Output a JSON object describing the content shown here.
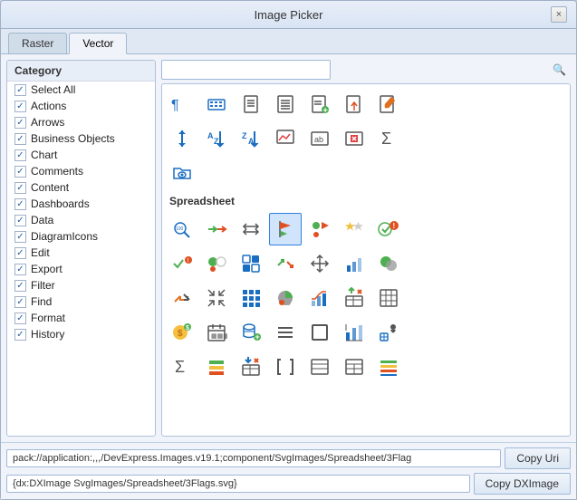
{
  "dialog": {
    "title": "Image Picker",
    "close_label": "×"
  },
  "tabs": [
    {
      "label": "Raster",
      "active": false
    },
    {
      "label": "Vector",
      "active": true
    }
  ],
  "sidebar": {
    "header": "Category",
    "items": [
      {
        "label": "Select All",
        "checked": true
      },
      {
        "label": "Actions",
        "checked": true
      },
      {
        "label": "Arrows",
        "checked": true
      },
      {
        "label": "Business Objects",
        "checked": true
      },
      {
        "label": "Chart",
        "checked": true
      },
      {
        "label": "Comments",
        "checked": true
      },
      {
        "label": "Content",
        "checked": true
      },
      {
        "label": "Dashboards",
        "checked": true
      },
      {
        "label": "Data",
        "checked": true
      },
      {
        "label": "DiagramIcons",
        "checked": true
      },
      {
        "label": "Edit",
        "checked": true
      },
      {
        "label": "Export",
        "checked": true
      },
      {
        "label": "Filter",
        "checked": true
      },
      {
        "label": "Find",
        "checked": true
      },
      {
        "label": "Format",
        "checked": true
      },
      {
        "label": "History",
        "checked": true
      }
    ]
  },
  "search": {
    "placeholder": "",
    "icon": "🔍"
  },
  "sections": [
    {
      "label": "",
      "icons": [
        "↵",
        "⌨",
        "📄",
        "📋",
        "📋+",
        "📤",
        "✏️",
        "↕",
        "↓Z",
        "↓Z",
        "📈",
        "ab",
        "🚫",
        "Σ",
        "📁👁"
      ]
    },
    {
      "label": "Spreadsheet",
      "icons": [
        "🔍100",
        "→→",
        "↔",
        "🚩",
        "🟢▲",
        "⭐⭐",
        "✅",
        "🔴",
        "✓!",
        "🔴⚪",
        "🟩🟩",
        "↑→",
        "↑↓",
        "📊",
        "🟢🟢",
        "🟣🔵",
        "↑↓",
        "↑↓",
        "📊",
        "↑x",
        "📊",
        "💰",
        "📅",
        "🗄+",
        "≡",
        "⬜",
        "📊",
        "∑",
        "≡↓",
        "↓x",
        "[]",
        "≡≡",
        "≡≡",
        "≡"
      ]
    }
  ],
  "bottom": {
    "uri_label": "pack://application:,,,/DevExpress.Images.v19.1;component/SvgImages/Spreadsheet/3Flag",
    "uri_btn": "Copy Uri",
    "dx_label": "{dx:DXImage SvgImages/Spreadsheet/3Flags.svg}",
    "dx_btn": "Copy DXImage"
  }
}
